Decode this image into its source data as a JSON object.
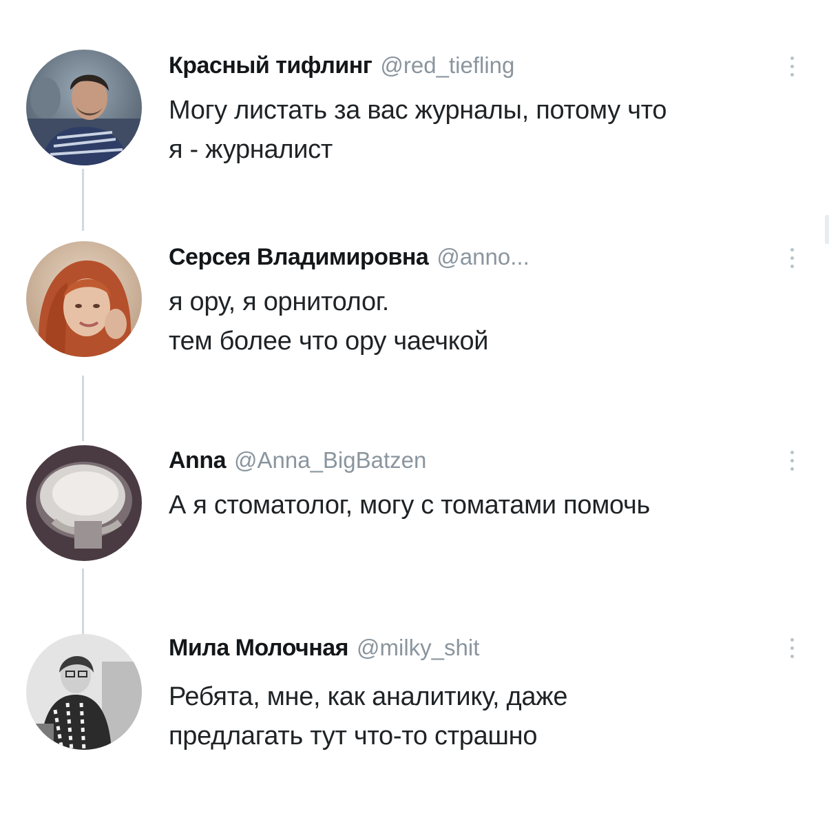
{
  "tweets": [
    {
      "name": "Красный тифлинг",
      "handle": "@red_tiefling",
      "lines": [
        "Могу листать за вас журналы, потому что",
        "я - журналист"
      ],
      "avatar_icon": "person-avatar-photo"
    },
    {
      "name": "Серсея Владимировна",
      "handle": "@anno...",
      "lines": [
        "я ору, я орнитолог.",
        "тем более что ору чаечкой"
      ],
      "avatar_icon": "person-avatar-photo"
    },
    {
      "name": "Anna",
      "handle": "@Anna_BigBatzen",
      "lines": [
        "А я стоматолог, могу с томатами помочь"
      ],
      "avatar_icon": "xray-skull-avatar"
    },
    {
      "name": "Мила Молочная",
      "handle": "@milky_shit",
      "lines": [
        "Ребята, мне, как аналитику, даже",
        "предлагать тут что-то страшно"
      ],
      "avatar_icon": "person-avatar-photo-bw"
    }
  ],
  "icons": {
    "more": "more-vertical-icon"
  },
  "colors": {
    "name": "#14171a",
    "handle": "#8a959e",
    "text": "#1f2326",
    "thread_line": "#cfd9de"
  }
}
